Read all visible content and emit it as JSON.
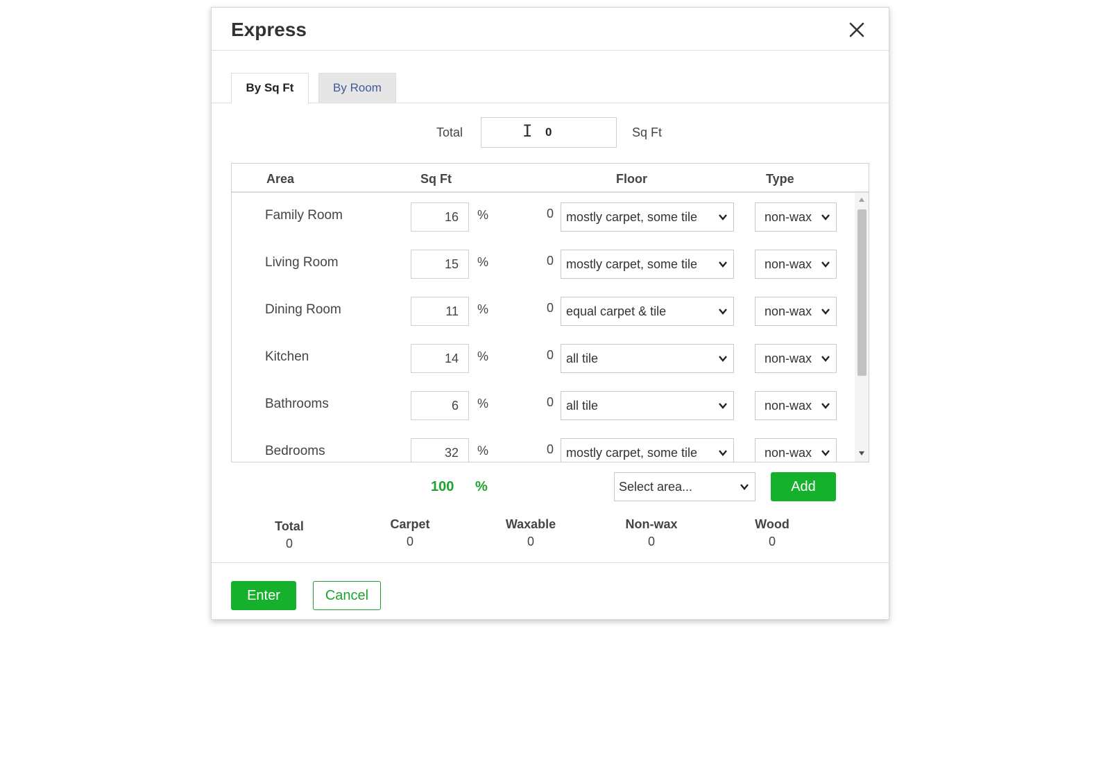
{
  "dialog": {
    "title": "Express",
    "close_icon": "close-icon"
  },
  "tabs": [
    {
      "label": "By Sq Ft",
      "active": true
    },
    {
      "label": "By Room",
      "active": false
    }
  ],
  "total_input": {
    "label": "Total",
    "value": "0",
    "unit": "Sq Ft"
  },
  "table": {
    "headers": {
      "area": "Area",
      "sqft": "Sq Ft",
      "floor": "Floor",
      "type": "Type"
    },
    "rows": [
      {
        "area": "Family Room",
        "sqft": "16",
        "pct": "%",
        "calc": "0",
        "floor": "mostly carpet, some tile",
        "type": "non-wax"
      },
      {
        "area": "Living Room",
        "sqft": "15",
        "pct": "%",
        "calc": "0",
        "floor": "mostly carpet, some tile",
        "type": "non-wax"
      },
      {
        "area": "Dining Room",
        "sqft": "11",
        "pct": "%",
        "calc": "0",
        "floor": "equal carpet & tile",
        "type": "non-wax"
      },
      {
        "area": "Kitchen",
        "sqft": "14",
        "pct": "%",
        "calc": "0",
        "floor": "all tile",
        "type": "non-wax"
      },
      {
        "area": "Bathrooms",
        "sqft": "6",
        "pct": "%",
        "calc": "0",
        "floor": "all tile",
        "type": "non-wax"
      },
      {
        "area": "Bedrooms",
        "sqft": "32",
        "pct": "%",
        "calc": "0",
        "floor": "mostly carpet, some tile",
        "type": "non-wax"
      }
    ]
  },
  "summary": {
    "pct_total": "100",
    "pct_symbol": "%",
    "select_area_placeholder": "Select area...",
    "add_label": "Add"
  },
  "totals": [
    {
      "label": "Total",
      "value": "0"
    },
    {
      "label": "Carpet",
      "value": "0"
    },
    {
      "label": "Waxable",
      "value": "0"
    },
    {
      "label": "Non-wax",
      "value": "0"
    },
    {
      "label": "Wood",
      "value": "0"
    }
  ],
  "footer": {
    "enter_label": "Enter",
    "cancel_label": "Cancel"
  },
  "colors": {
    "accent_green": "#16b12c",
    "tab_link_blue": "#3d5b9a"
  }
}
